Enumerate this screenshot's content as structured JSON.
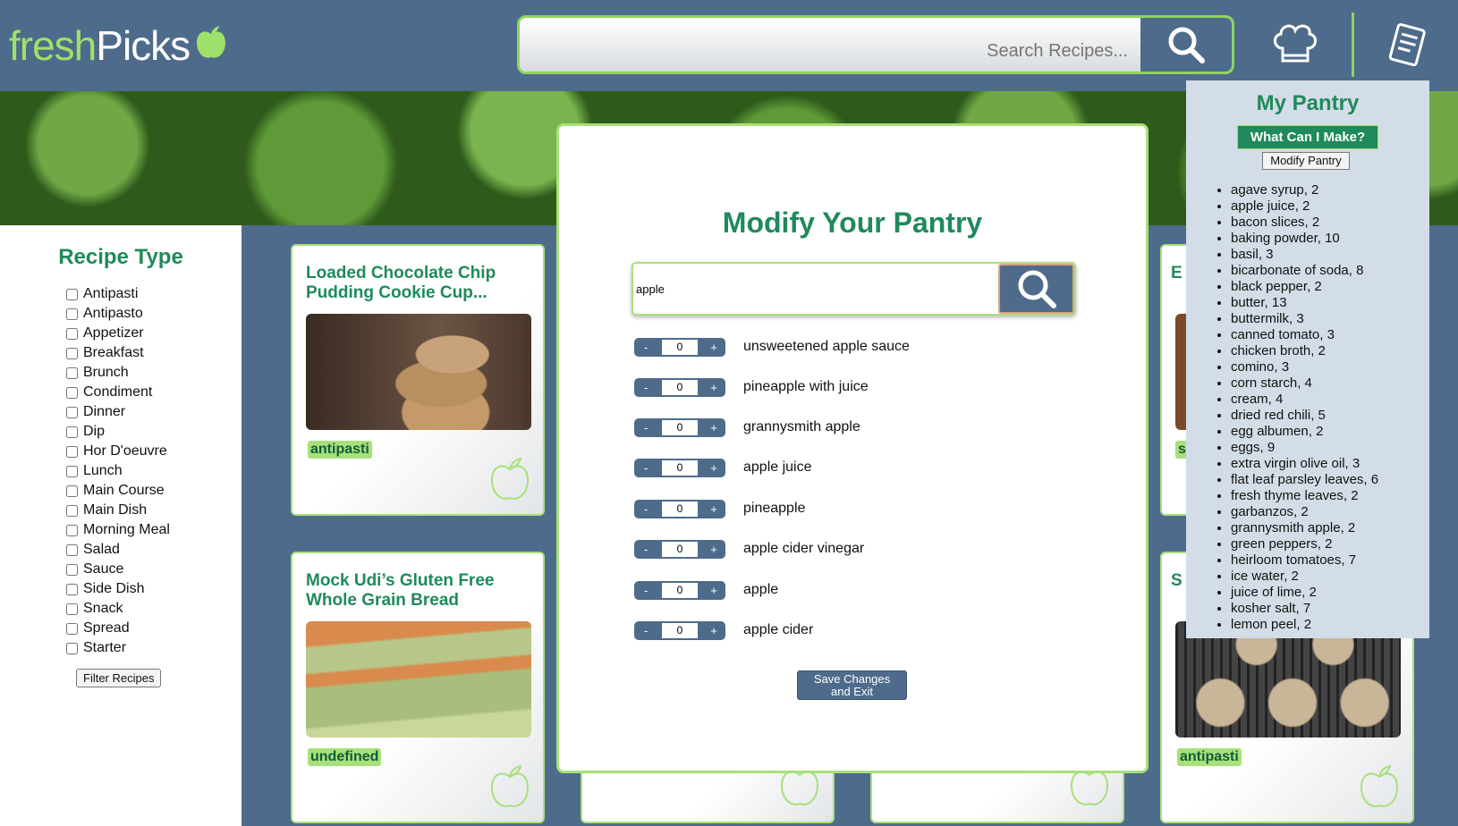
{
  "header": {
    "logo_fresh": "fresh",
    "logo_picks": "Picks",
    "search_placeholder": "Search Recipes...",
    "icons": [
      "apple-logo-icon",
      "search-icon",
      "chef-hat-icon",
      "recipe-list-icon"
    ]
  },
  "sidebar": {
    "title": "Recipe Type",
    "types": [
      "Antipasti",
      "Antipasto",
      "Appetizer",
      "Breakfast",
      "Brunch",
      "Condiment",
      "Dinner",
      "Dip",
      "Hor D'oeuvre",
      "Lunch",
      "Main Course",
      "Main Dish",
      "Morning Meal",
      "Salad",
      "Sauce",
      "Side Dish",
      "Snack",
      "Spread",
      "Starter"
    ],
    "filter_button": "Filter Recipes"
  },
  "cards": [
    {
      "title": "Loaded Chocolate Chip Pudding Cookie Cup...",
      "tag": "antipasti"
    },
    {
      "title": "Mock Udi’s Gluten Free Whole Grain Bread",
      "tag": "undefined"
    },
    {
      "title_partial": "E",
      "tag_partial": "s"
    },
    {
      "title_partial": "S",
      "tag": "antipasti"
    }
  ],
  "modal": {
    "title": "Modify Your Pantry",
    "search_value": "apple",
    "items": [
      {
        "label": "unsweetened apple sauce",
        "qty": "0"
      },
      {
        "label": "pineapple with juice",
        "qty": "0"
      },
      {
        "label": "grannysmith apple",
        "qty": "0"
      },
      {
        "label": "apple juice",
        "qty": "0"
      },
      {
        "label": "pineapple",
        "qty": "0"
      },
      {
        "label": "apple cider vinegar",
        "qty": "0"
      },
      {
        "label": "apple",
        "qty": "0"
      },
      {
        "label": "apple cider",
        "qty": "0"
      }
    ],
    "minus": "-",
    "plus": "+",
    "save_line1": "Save Changes",
    "save_line2": "and Exit"
  },
  "pantry": {
    "title": "My Pantry",
    "make_button": "What Can I Make?",
    "modify_button": "Modify Pantry",
    "items": [
      "agave syrup, 2",
      "apple juice, 2",
      "bacon slices, 2",
      "baking powder, 10",
      "basil, 3",
      "bicarbonate of soda, 8",
      "black pepper, 2",
      "butter, 13",
      "buttermilk, 3",
      "canned tomato, 3",
      "chicken broth, 2",
      "comino, 3",
      "corn starch, 4",
      "cream, 4",
      "dried red chili, 5",
      "egg albumen, 2",
      "eggs, 9",
      "extra virgin olive oil, 3",
      "flat leaf parsley leaves, 6",
      "fresh thyme leaves, 2",
      "garbanzos, 2",
      "grannysmith apple, 2",
      "green peppers, 2",
      "heirloom tomatoes, 7",
      "ice water, 2",
      "juice of lime, 2",
      "kosher salt, 7",
      "lemon peel, 2"
    ]
  },
  "colors": {
    "brand_green": "#1f8a5b",
    "accent_lime": "#a8e07b",
    "slate_blue": "#4e6b8b",
    "pantry_bg": "#d3dde7"
  }
}
